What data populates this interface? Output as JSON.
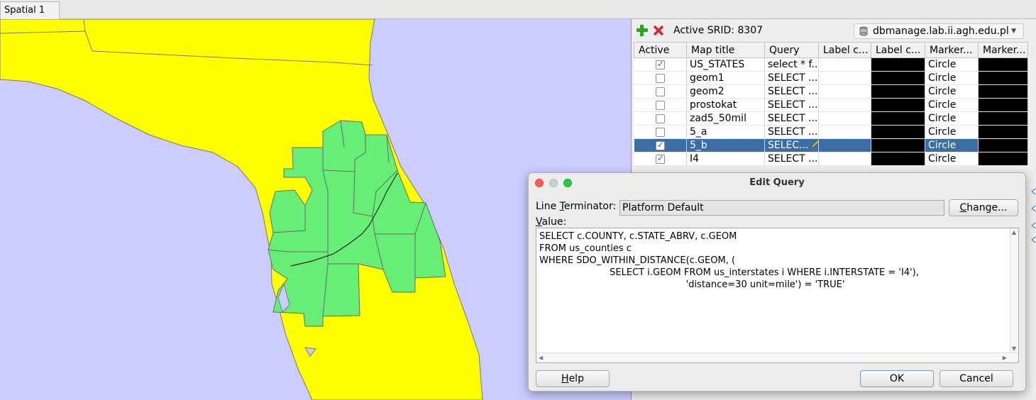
{
  "tab": {
    "label": "Spatial 1"
  },
  "toolbar": {
    "srid_label": "Active SRID: 8307",
    "connection": "dbmanage.lab.ii.agh.edu.pl"
  },
  "grid": {
    "headers": [
      "Active",
      "Map title",
      "Query",
      "Label c...",
      "Label c...",
      "Marker...",
      "Marker..."
    ],
    "rows": [
      {
        "active": true,
        "title": "US_STATES",
        "query": "select * f...",
        "marker": "Circle"
      },
      {
        "active": false,
        "title": "geom1",
        "query": "SELECT ...",
        "marker": "Circle"
      },
      {
        "active": false,
        "title": "geom2",
        "query": "SELECT ...",
        "marker": "Circle"
      },
      {
        "active": false,
        "title": "prostokat",
        "query": "SELECT  ...",
        "marker": "Circle"
      },
      {
        "active": false,
        "title": "zad5_50mil",
        "query": "SELECT ...",
        "marker": "Circle"
      },
      {
        "active": false,
        "title": "5_a",
        "query": "SELECT ...",
        "marker": "Circle"
      },
      {
        "active": true,
        "title": "5_b",
        "query": "SELEC...",
        "marker": "Circle",
        "selected": true
      },
      {
        "active": true,
        "title": "I4",
        "query": "SELECT ...",
        "marker": "Circle"
      }
    ]
  },
  "dialog": {
    "title": "Edit Query",
    "line_terminator_label": "Line Terminator:",
    "line_terminator_value": "Platform Default",
    "change_button": "Change...",
    "value_label": "Value:",
    "query_text": "SELECT c.COUNTY, c.STATE_ABRV, c.GEOM\nFROM us_counties c\nWHERE SDO_WITHIN_DISTANCE(c.GEOM, (\n                        SELECT i.GEOM FROM us_interstates i WHERE i.INTERSTATE = 'I4'),\n                                                  'distance=30 unit=mile') = 'TRUE'",
    "help_button": "Help",
    "ok_button": "OK",
    "cancel_button": "Cancel"
  },
  "colors": {
    "water": "#ccccff",
    "state": "#ffff00",
    "counties": "#66ee77",
    "selection": "#3a6ea5"
  }
}
